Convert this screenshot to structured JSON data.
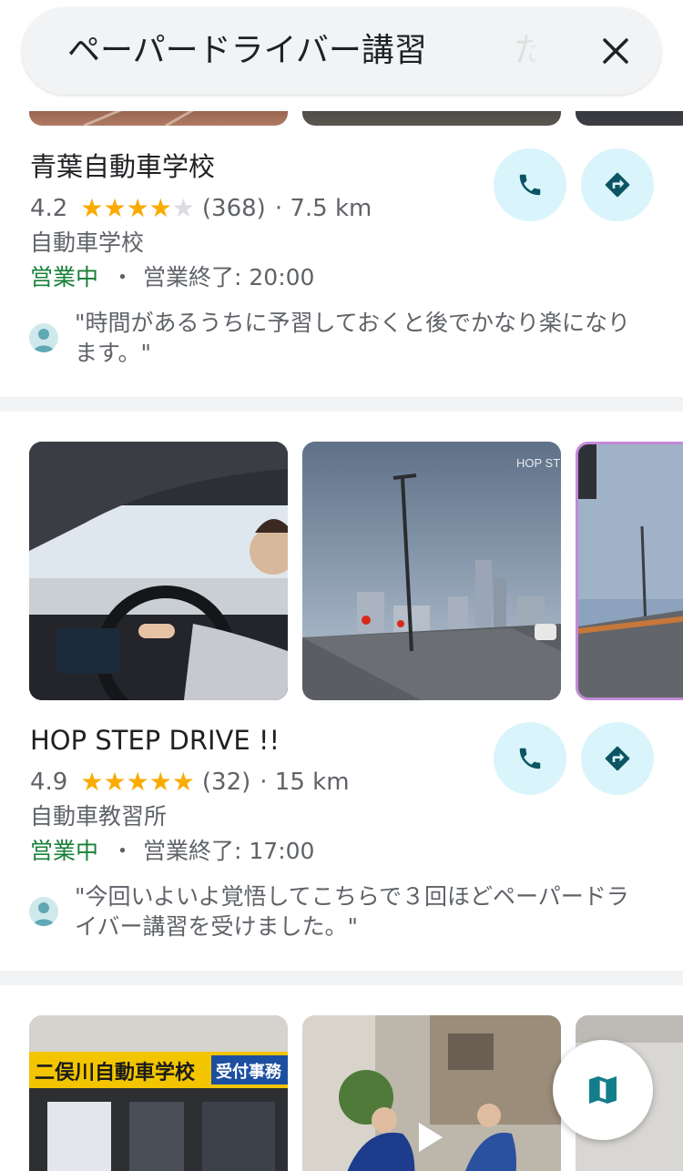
{
  "search": {
    "query": "ペーパードライバー講習",
    "trailing": "た"
  },
  "results": [
    {
      "name": "青葉自動車学校",
      "rating": "4.2",
      "stars": 4.2,
      "reviews": "(368)",
      "distance": "· 7.5 km",
      "category": "自動車学校",
      "status": "営業中",
      "separator": "・",
      "closing": "営業終了: 20:00",
      "review": "\"時間があるうちに予習しておくと後でかなり楽になります。\""
    },
    {
      "name": "HOP STEP DRIVE !!",
      "rating": "4.9",
      "stars": 5,
      "reviews": "(32)",
      "distance": "· 15 km",
      "category": "自動車教習所",
      "status": "営業中",
      "separator": "・",
      "closing": "営業終了: 17:00",
      "review": "\"今回いよいよ覚悟してこちらで３回ほどペーパードライバー講習を受けました。\"",
      "photo_watermark": "HOP ST"
    },
    {
      "sign_text": "二俣川自動車学校",
      "sign_text_2": "受付事務"
    }
  ],
  "colors": {
    "star": "#f9ab00",
    "open": "#188038",
    "action_button_bg": "#d9f4fb",
    "action_icon": "#0b5563",
    "map_icon": "#137e8a"
  },
  "icons": {
    "close": "close-icon",
    "phone": "phone-icon",
    "directions": "directions-icon",
    "map": "map-icon",
    "avatar": "avatar-icon",
    "play": "play-icon"
  }
}
